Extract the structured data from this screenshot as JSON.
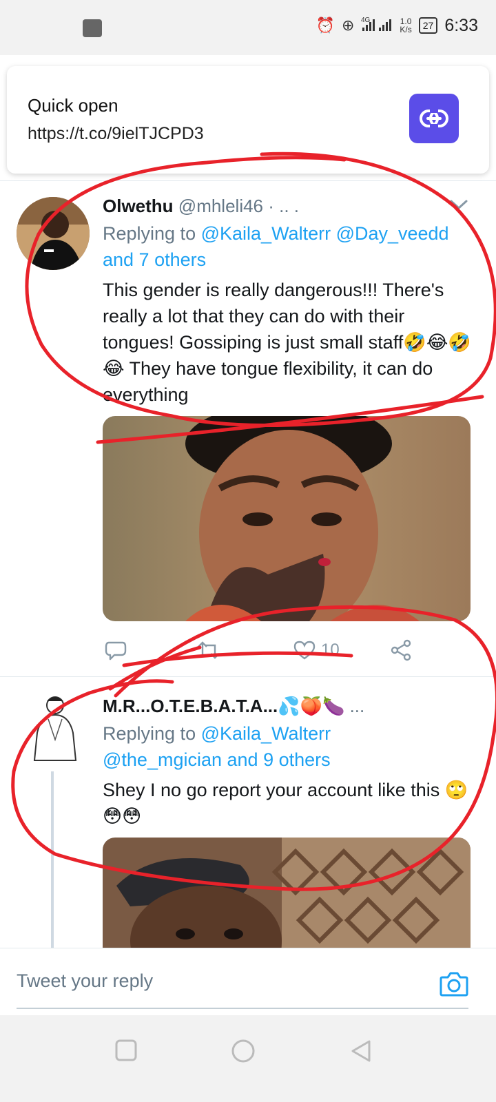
{
  "status_bar": {
    "network_rate_value": "1.0",
    "network_rate_unit": "K/s",
    "signal_label": "4G",
    "battery": "27",
    "time": "6:33"
  },
  "quick_open": {
    "title": "Quick open",
    "url": "https://t.co/9ielTJCPD3",
    "button_icon": "link-icon",
    "accent_color": "#5b4de8"
  },
  "tweets": [
    {
      "name": "Olwethu",
      "handle": "@mhleli46",
      "handle_suffix": " · .. .",
      "reply_prefix": "Replying to",
      "reply_links": "@Kaila_Walterr @Day_veedd",
      "reply_others": "and 7 others",
      "text": "This gender is really dangerous!!! There's really a lot that they can do with their tongues! Gossiping is just small staff🤣😂🤣😂 They have tongue flexibility, it can do everything",
      "likes": "10"
    },
    {
      "name": "M.R...O.T.E.B.A.T.A...💦🍑🍆",
      "name_suffix": " ...",
      "reply_prefix": "Replying to",
      "reply_links": "@Kaila_Walterr",
      "reply_links_2": "@the_mgician",
      "reply_others": "and 9 others",
      "text": "Shey I no go report your account like this 🙄😳😳"
    }
  ],
  "composer": {
    "placeholder": "Tweet your reply"
  },
  "colors": {
    "link": "#1da1f2",
    "secondary_text": "#657786",
    "annotation": "#e8222a"
  }
}
